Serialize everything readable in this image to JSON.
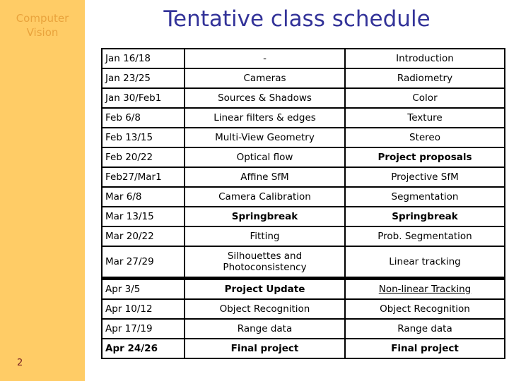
{
  "sidebar": {
    "course_title": "Computer Vision",
    "page_number": "2",
    "background_color": "#ffcc66",
    "text_color": "#e9a33c",
    "page_number_color": "#7a2020"
  },
  "slide": {
    "title": "Tentative class schedule",
    "title_color": "#333399"
  },
  "schedule": {
    "rows": [
      {
        "date": "Jan 16/18",
        "tue": "-",
        "thu": "Introduction"
      },
      {
        "date": "Jan 23/25",
        "tue": "Cameras",
        "thu": "Radiometry"
      },
      {
        "date": "Jan 30/Feb1",
        "tue": "Sources & Shadows",
        "thu": "Color"
      },
      {
        "date": "Feb 6/8",
        "tue": "Linear filters & edges",
        "thu": "Texture"
      },
      {
        "date": "Feb 13/15",
        "tue": "Multi-View Geometry",
        "thu": "Stereo"
      },
      {
        "date": "Feb 20/22",
        "tue": "Optical flow",
        "thu": "Project proposals"
      },
      {
        "date": "Feb27/Mar1",
        "tue": "Affine SfM",
        "thu": "Projective SfM"
      },
      {
        "date": "Mar 6/8",
        "tue": "Camera Calibration",
        "thu": "Segmentation"
      },
      {
        "date": "Mar 13/15",
        "tue": "Springbreak",
        "thu": "Springbreak"
      },
      {
        "date": "Mar 20/22",
        "tue": "Fitting",
        "thu": "Prob. Segmentation"
      },
      {
        "date": "Mar 27/29",
        "tue": "Silhouettes and Photoconsistency",
        "tue_line1": "Silhouettes and",
        "tue_line2": "Photoconsistency",
        "thu": "Linear tracking"
      },
      {
        "date": "Apr 3/5",
        "tue": "Project Update",
        "thu": "Non-linear Tracking"
      },
      {
        "date": "Apr 10/12",
        "tue": "Object Recognition",
        "thu": "Object Recognition"
      },
      {
        "date": "Apr 17/19",
        "tue": "Range data",
        "thu": "Range data"
      },
      {
        "date": "Apr 24/26",
        "tue": "Final project",
        "thu": "Final project"
      }
    ]
  }
}
